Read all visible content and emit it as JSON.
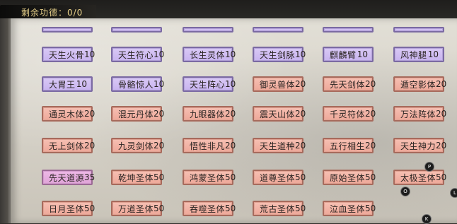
{
  "header": {
    "merit_text": "剩余功德：0/0"
  },
  "cards": [
    {
      "name": "",
      "value": "",
      "style": "purple"
    },
    {
      "name": "",
      "value": "",
      "style": "purple"
    },
    {
      "name": "",
      "value": "",
      "style": "purple"
    },
    {
      "name": "",
      "value": "",
      "style": "purple"
    },
    {
      "name": "",
      "value": "",
      "style": "purple"
    },
    {
      "name": "",
      "value": "",
      "style": "purple"
    },
    {
      "name": "天生火骨",
      "value": "10",
      "style": "purple"
    },
    {
      "name": "天生符心",
      "value": "10",
      "style": "purple"
    },
    {
      "name": "长生灵体",
      "value": "10",
      "style": "purple"
    },
    {
      "name": "天生剑脉",
      "value": "10",
      "style": "purple"
    },
    {
      "name": "麒麟臂",
      "value": "10",
      "style": "purple"
    },
    {
      "name": "风神腿",
      "value": "10",
      "style": "purple"
    },
    {
      "name": "大胃王",
      "value": "10",
      "style": "purple"
    },
    {
      "name": "骨骼惊人",
      "value": "10",
      "style": "purple"
    },
    {
      "name": "天生阵心",
      "value": "10",
      "style": "purple"
    },
    {
      "name": "御灵兽体",
      "value": "20",
      "style": "red"
    },
    {
      "name": "先天剑体",
      "value": "20",
      "style": "red"
    },
    {
      "name": "遁空影体",
      "value": "20",
      "style": "red"
    },
    {
      "name": "通灵木体",
      "value": "20",
      "style": "red"
    },
    {
      "name": "混元丹体",
      "value": "20",
      "style": "red"
    },
    {
      "name": "九眼器体",
      "value": "20",
      "style": "red"
    },
    {
      "name": "震天山体",
      "value": "20",
      "style": "red"
    },
    {
      "name": "千灵符体",
      "value": "20",
      "style": "red"
    },
    {
      "name": "万法阵体",
      "value": "20",
      "style": "red"
    },
    {
      "name": "无上剑体",
      "value": "20",
      "style": "red"
    },
    {
      "name": "九灵剑体",
      "value": "20",
      "style": "red"
    },
    {
      "name": "悟性非凡",
      "value": "20",
      "style": "red"
    },
    {
      "name": "天生道种",
      "value": "20",
      "style": "red"
    },
    {
      "name": "五行相生",
      "value": "20",
      "style": "red"
    },
    {
      "name": "天生神力",
      "value": "20",
      "style": "red"
    },
    {
      "name": "先天道源",
      "value": "35",
      "style": "pink"
    },
    {
      "name": "乾坤圣体",
      "value": "50",
      "style": "red"
    },
    {
      "name": "鸿蒙圣体",
      "value": "50",
      "style": "red"
    },
    {
      "name": "道尊圣体",
      "value": "50",
      "style": "red"
    },
    {
      "name": "原始圣体",
      "value": "50",
      "style": "red"
    },
    {
      "name": "太极圣体",
      "value": "50",
      "style": "red"
    },
    {
      "name": "日月圣体",
      "value": "50",
      "style": "red"
    },
    {
      "name": "万道圣体",
      "value": "50",
      "style": "red"
    },
    {
      "name": "吞噬圣体",
      "value": "50",
      "style": "red"
    },
    {
      "name": "荒古圣体",
      "value": "50",
      "style": "red"
    },
    {
      "name": "泣血圣体",
      "value": "50",
      "style": "red"
    }
  ],
  "overlay_buttons": [
    {
      "label": "P"
    },
    {
      "label": "O"
    },
    {
      "label": "L"
    },
    {
      "label": "K"
    }
  ]
}
